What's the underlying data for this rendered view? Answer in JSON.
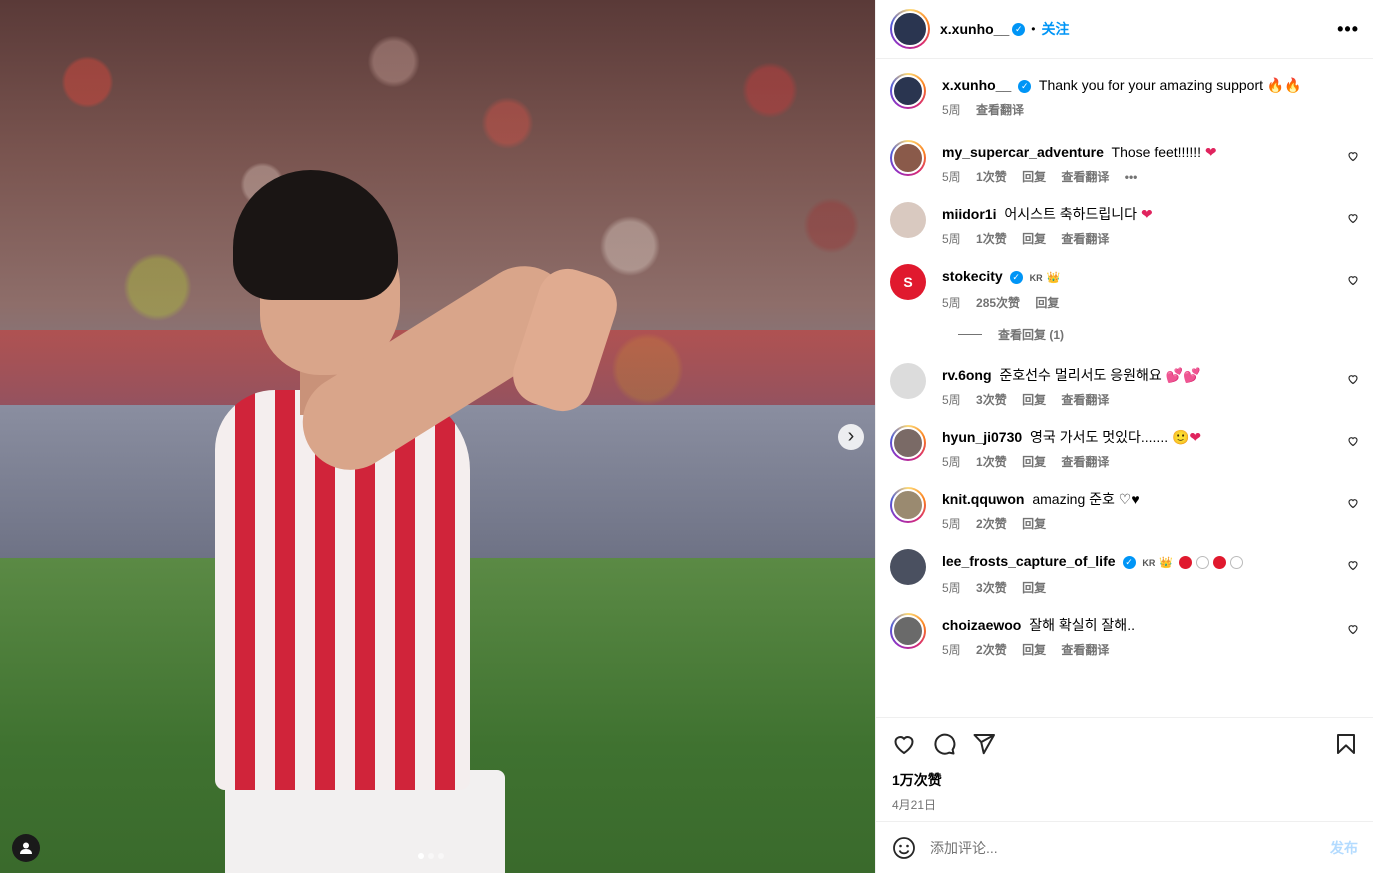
{
  "post_owner": {
    "username": "x.xunho__",
    "verified": true,
    "follow_label": "关注",
    "separator": "•"
  },
  "caption": {
    "username": "x.xunho__",
    "text": "Thank you for your amazing support 🔥🔥",
    "time": "5周",
    "translate": "查看翻译"
  },
  "comments": [
    {
      "username": "my_supercar_adventure",
      "text": "Those feet!!!!!!",
      "emoji": "❤",
      "time": "5周",
      "likes": "1次赞",
      "reply": "回复",
      "translate": "查看翻译",
      "more": "•••",
      "avatar_color": "#8a5a4a"
    },
    {
      "username": "miidor1i",
      "text": "어시스트 축하드립니다",
      "emoji": "❤",
      "time": "5周",
      "likes": "1次赞",
      "reply": "回复",
      "translate": "查看翻译",
      "avatar_color": "#d9c9c0"
    },
    {
      "username": "stokecity",
      "text": "",
      "badge": "KR",
      "crown": "👑",
      "time": "5周",
      "likes": "285次赞",
      "reply": "回复",
      "avatar_color": "#e0192e"
    },
    {
      "username": "rv.6ong",
      "text": "준호선수 멀리서도 응원해요",
      "emoji": "💕💕",
      "time": "5周",
      "likes": "3次赞",
      "reply": "回复",
      "translate": "查看翻译",
      "avatar_color": "#dcdcdc"
    },
    {
      "username": "hyun_ji0730",
      "text": "영국 가서도 멋있다.......",
      "emoji": "🙂❤",
      "time": "5周",
      "likes": "1次赞",
      "reply": "回复",
      "translate": "查看翻译",
      "avatar_color": "#7a6a66"
    },
    {
      "username": "knit.qquwon",
      "text": "amazing 준호",
      "emoji": "♡♥",
      "time": "5周",
      "likes": "2次赞",
      "reply": "回复",
      "avatar_color": "#9a8a70"
    },
    {
      "username": "lee_frosts_capture_of_life",
      "text": "",
      "badge": "KR",
      "crown": "👑",
      "time": "5周",
      "likes": "3次赞",
      "reply": "回复",
      "avatar_color": "#4a5060"
    },
    {
      "username": "choizaewoo",
      "text": "잘해 확실히 잘해..",
      "time": "5周",
      "likes": "2次赞",
      "reply": "回复",
      "translate": "查看翻译",
      "avatar_color": "#6a6a6a"
    }
  ],
  "view_replies": "查看回复 (1)",
  "likes_count": "1万次赞",
  "post_date": "4月21日",
  "comment_input": {
    "placeholder": "添加评论...",
    "post_label": "发布"
  },
  "colors": {
    "link": "#0095f6",
    "meta": "#737373",
    "heart": "#e0245e"
  },
  "icons": [
    "heart-icon",
    "comment-icon",
    "share-icon",
    "save-icon",
    "emoji-icon",
    "chevron-right-icon",
    "tagged-user-icon",
    "more-icon"
  ]
}
